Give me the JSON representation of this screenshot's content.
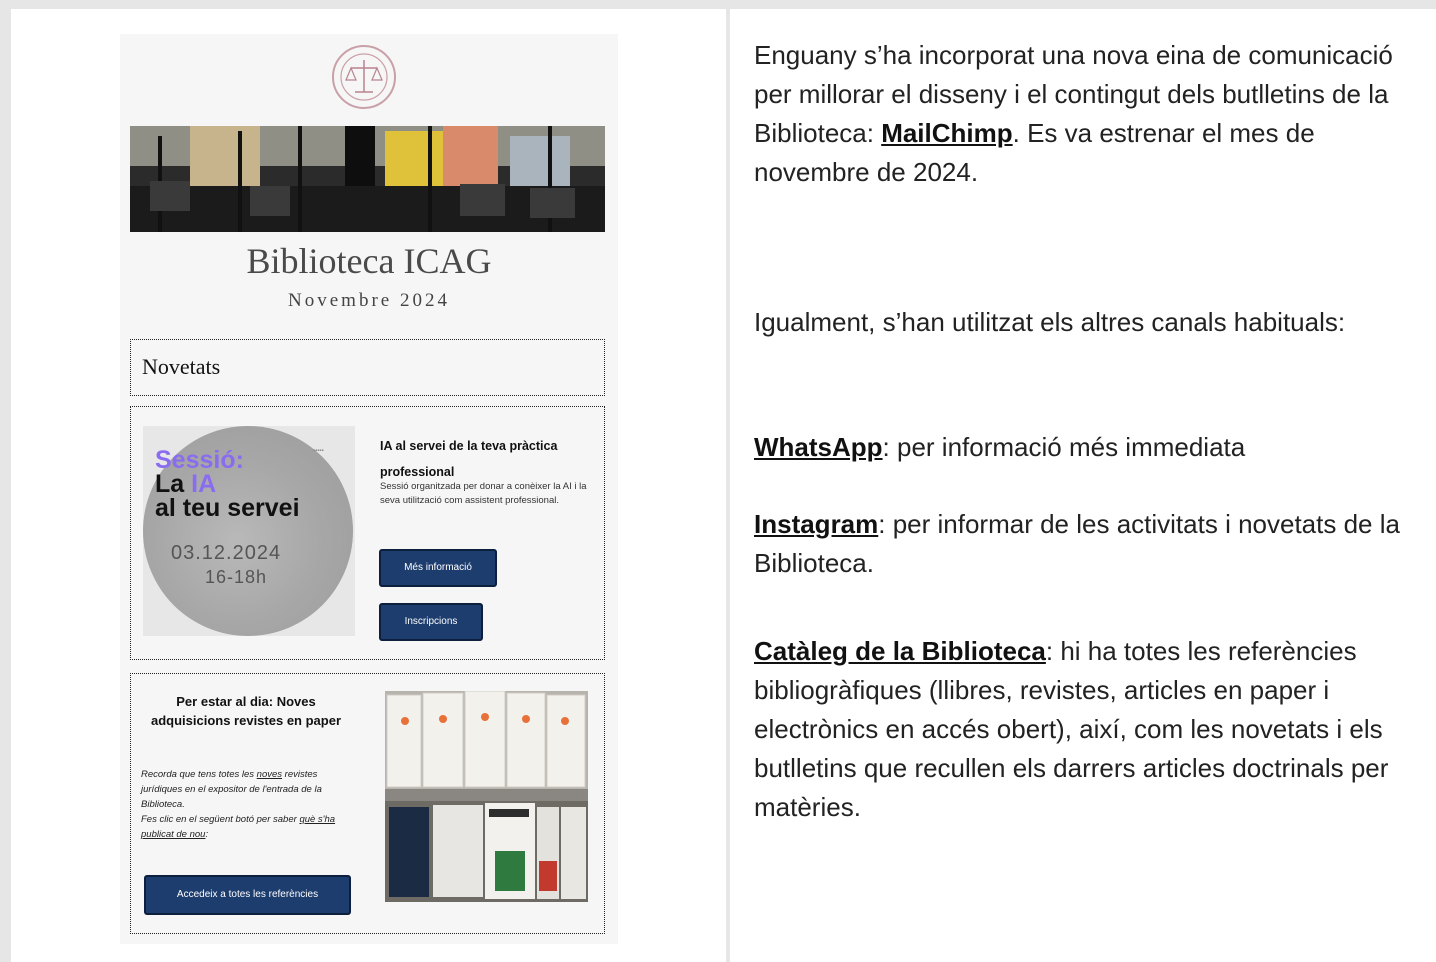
{
  "newsletter": {
    "title": "Biblioteca ICAG",
    "subtitle": "Novembre 2024",
    "section_title": "Novetats",
    "ia_card": {
      "image_line1": "Sessió:",
      "image_line2_a": "La ",
      "image_line2_b": "IA",
      "image_line3": "al teu servei",
      "image_date": "03.12.2024",
      "image_hour": "16-18h",
      "headline": "IA al servei de la teva pràctica professional",
      "description": "Sessió organitzada per donar a conèixer la AI i la seva utilització com assistent professional.",
      "button_more": "Més informació",
      "button_register": "Inscripcions"
    },
    "journals_card": {
      "headline": "Per estar al dia: Noves adquisicions revistes en paper",
      "body_1": "Recorda que tens totes les ",
      "body_link_1": "noves",
      "body_2": " revistes jurídiques en el expositor de l'entrada de la Biblioteca.",
      "body_3": "Fes clic en el següent botó per saber ",
      "body_link_2": "què s'ha publicat de nou",
      "body_4": ":",
      "button": "Accedeix a totes les referències"
    }
  },
  "article": {
    "p1_before": "Enguany s’ha incorporat una nova eina de comunicació per millorar el disseny i el contingut dels butlletins de la Biblioteca: ",
    "p1_link": "MailChimp",
    "p1_after": ". Es va estrenar el mes de novembre de 2024.",
    "p2": "Igualment, s’han utilitzat els altres canals habituals:",
    "p3_link": "WhatsApp",
    "p3_after": ": per informació més immediata",
    "p4_link": "Instagram",
    "p4_after": ": per informar de les activitats i novetats de la Biblioteca.",
    "p5_link": "Catàleg de la Biblioteca",
    "p5_after": ": hi ha totes les referències bibliogràfiques (llibres, revistes, articles en paper i electrònics en accés obert), així, com les novetats i els butlletins que recullen els darrers articles doctrinals per matèries."
  }
}
